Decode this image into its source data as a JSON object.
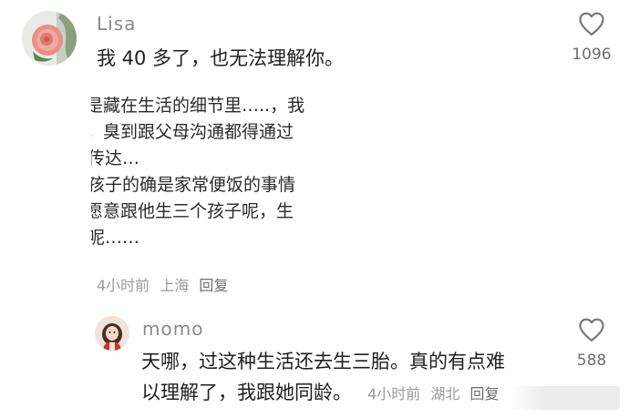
{
  "comment": {
    "username": "Lisa",
    "text": "我 40 多了，也无法理解你。",
    "quote_lines": [
      "是藏在生活的细节里…..，我",
      "臭到跟父母沟通都得通过",
      "传达…",
      "孩子的确是家常便饭的事情",
      "愿意跟他生三个孩子呢，生",
      "呢……"
    ],
    "quote_prefix": [
      "，",
      "",
      "",
      "",
      "",
      ""
    ],
    "time": "4小时前",
    "location": "上海",
    "reply_label": "回复",
    "likes": "1096",
    "like_icon": "heart-outline-icon"
  },
  "reply": {
    "username": "momo",
    "text_line1": "天哪，过这种生活还去生三胎。真的有点难",
    "text_line2": "以理解了，我跟她同龄。",
    "time": "4小时前",
    "location": "湖北",
    "reply_label": "回复",
    "likes": "588",
    "like_icon": "heart-outline-icon"
  },
  "colors": {
    "text": "#1f1f1f",
    "muted": "#9a9a9a",
    "username": "#8a8a8a"
  }
}
